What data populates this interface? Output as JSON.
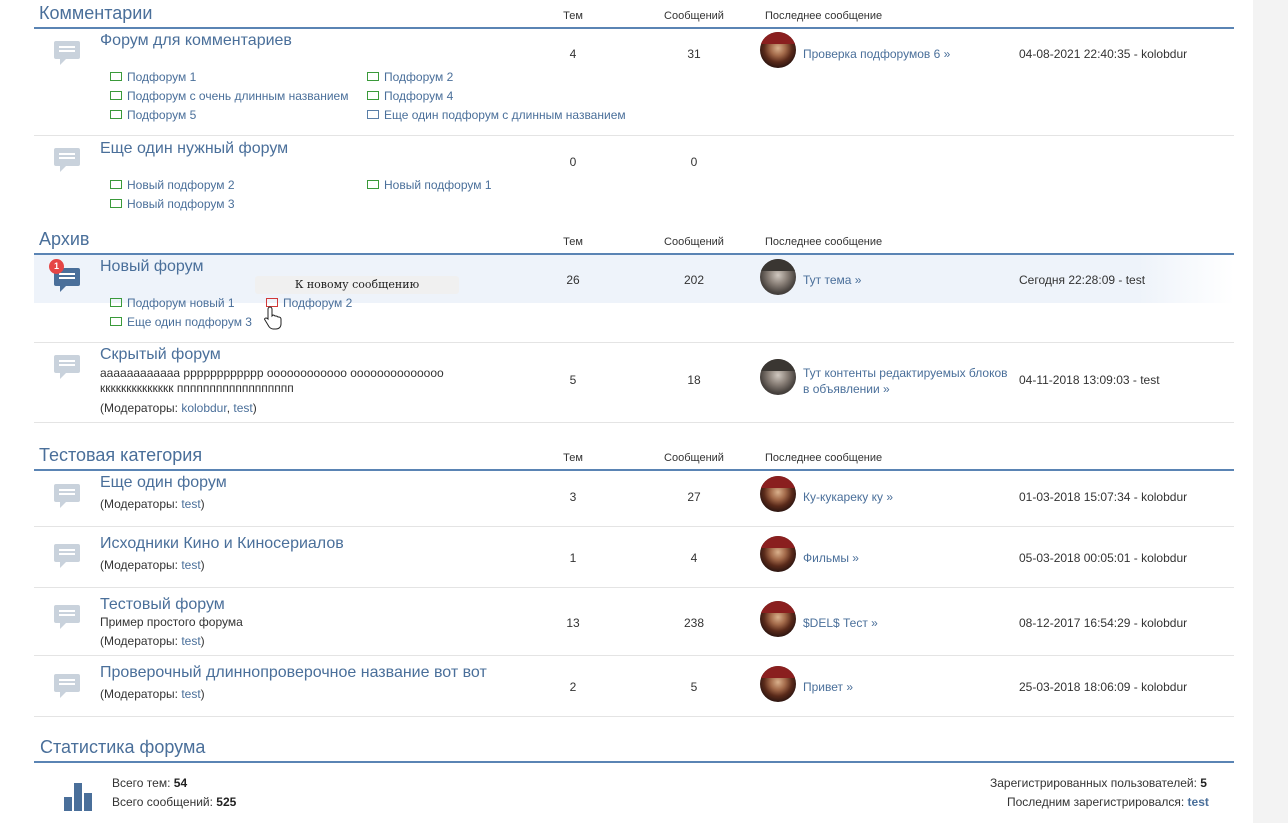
{
  "columns": {
    "topics": "Тем",
    "messages": "Сообщений",
    "last": "Последнее сообщение"
  },
  "categories": [
    {
      "title": "Комментарии"
    },
    {
      "title": "Архив"
    },
    {
      "title": "Тестовая категория"
    }
  ],
  "forums": [
    {
      "title": "Форум для комментариев",
      "topics": "4",
      "messages": "31",
      "last_link": "Проверка подфорумов 6 »",
      "last_date": "04-08-2021 22:40:35 - kolobdur",
      "subforums": [
        "Подфорум 1",
        "Подфорум 2",
        "Подфорум с очень длинным названием",
        "Подфорум 4",
        "Подфорум 5",
        "Еще один подфорум с длинным названием"
      ]
    },
    {
      "title": "Еще один нужный форум",
      "topics": "0",
      "messages": "0",
      "subforums": [
        "Новый подфорум 2",
        "Новый подфорум 1",
        "Новый подфорум 3"
      ]
    },
    {
      "title": "Новый форум",
      "badge": "1",
      "topics": "26",
      "messages": "202",
      "last_link": "Тут тема »",
      "last_date": "Сегодня 22:28:09 - test",
      "subforums": [
        "Подфорум новый 1",
        "Подфорум 2",
        "Еще один подфорум 3"
      ],
      "tooltip": "К новому сообщению"
    },
    {
      "title": "Скрытый форум",
      "topics": "5",
      "messages": "18",
      "desc1": "аааааааааааа рррррррррррр оооооооооооо оооооооооооооо",
      "desc2": "кккккккккккккк пппппппппппппппппп",
      "mods_label": "(Модераторы: ",
      "mods": [
        "kolobdur",
        "test"
      ],
      "mods_close": ")",
      "last_link": "Тут контенты редактируемых блоков в объявлении »",
      "last_date": "04-11-2018 13:09:03 - test"
    },
    {
      "title": "Еще один форум",
      "topics": "3",
      "messages": "27",
      "mods_label": "(Модераторы: ",
      "mods": [
        "test"
      ],
      "mods_close": ")",
      "last_link": "Ку-кукареку ку »",
      "last_date": "01-03-2018 15:07:34 - kolobdur"
    },
    {
      "title": "Исходники Кино и Киносериалов",
      "topics": "1",
      "messages": "4",
      "mods_label": "(Модераторы: ",
      "mods": [
        "test"
      ],
      "mods_close": ")",
      "last_link": "Фильмы »",
      "last_date": "05-03-2018 00:05:01 - kolobdur"
    },
    {
      "title": "Тестовый форум",
      "topics": "13",
      "messages": "238",
      "desc1": "Пример простого форума",
      "mods_label": "(Модераторы: ",
      "mods": [
        "test"
      ],
      "mods_close": ")",
      "last_link": "$DEL$ Тест »",
      "last_date": "08-12-2017 16:54:29 - kolobdur"
    },
    {
      "title": "Проверочный длиннопроверочное название вот вот",
      "topics": "2",
      "messages": "5",
      "mods_label": "(Модераторы: ",
      "mods": [
        "test"
      ],
      "mods_close": ")",
      "last_link": "Привет »",
      "last_date": "25-03-2018 18:06:09 - kolobdur"
    }
  ],
  "stats": {
    "title": "Статистика форума",
    "topics_label": "Всего тем: ",
    "topics": "54",
    "messages_label": "Всего сообщений: ",
    "messages": "525",
    "users_label": "Зарегистрированных пользователей: ",
    "users": "5",
    "last_user_label": "Последним зарегистрировался: ",
    "last_user": "test"
  },
  "colors": {
    "accent": "#4a6f9a",
    "new_mail": "#d13838",
    "mail": "#3a9a3a",
    "badge": "#e64545"
  }
}
